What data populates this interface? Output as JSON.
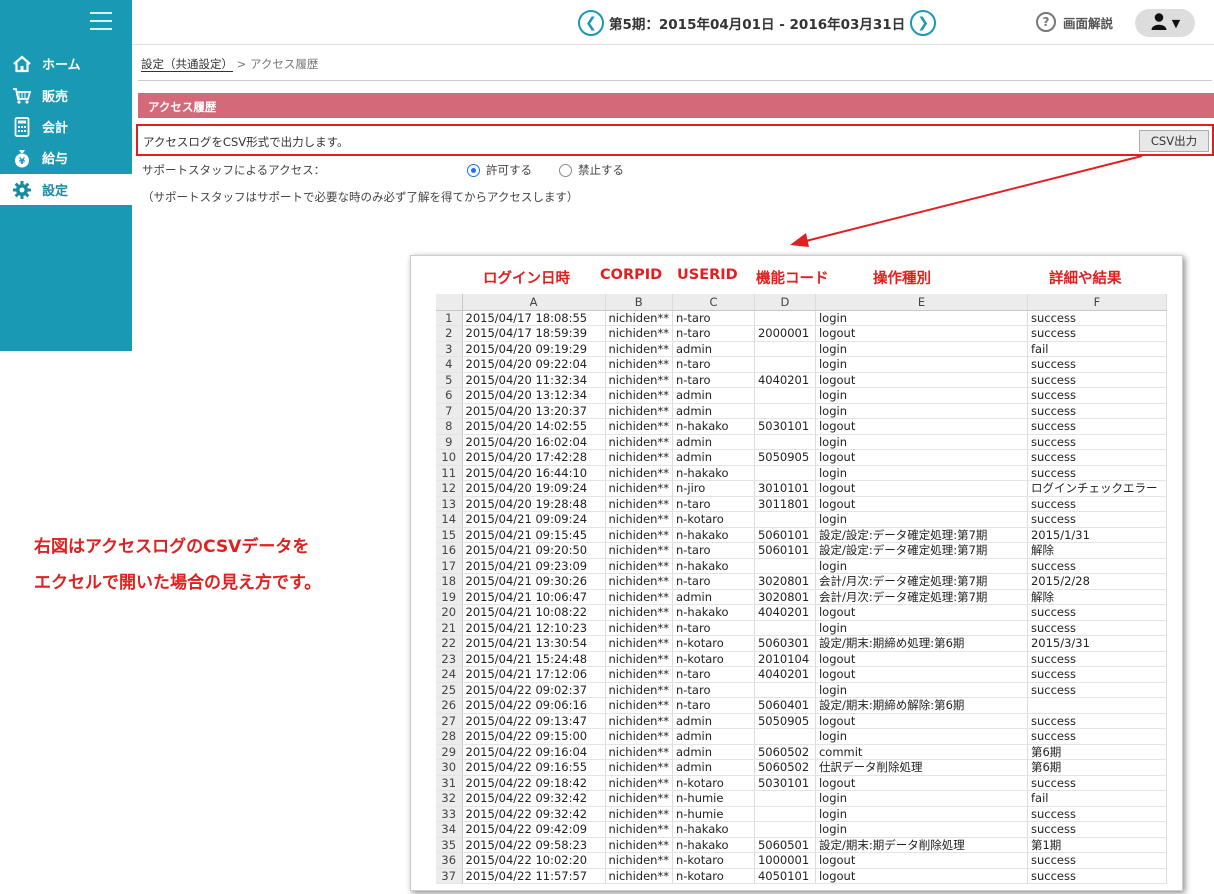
{
  "nav": {
    "items": [
      {
        "label": "ホーム",
        "icon": "home-icon"
      },
      {
        "label": "販売",
        "icon": "cart-icon"
      },
      {
        "label": "会計",
        "icon": "calculator-icon"
      },
      {
        "label": "給与",
        "icon": "money-bag-icon"
      },
      {
        "label": "設定",
        "icon": "gear-icon"
      }
    ]
  },
  "header": {
    "period": "第5期：2015年04月01日 - 2016年03月31日",
    "help_label": "画面解説"
  },
  "breadcrumb": {
    "parent": "設定（共通設定）",
    "separator": " > ",
    "current": "アクセス履歴"
  },
  "section": {
    "title": "アクセス履歴",
    "csv_description": "アクセスログをCSV形式で出力します。",
    "csv_button": "CSV出力",
    "support_label": "サポートスタッフによるアクセス：",
    "allow_label": "許可する",
    "deny_label": "禁止する",
    "support_note": "（サポートスタッフはサポートで必要な時のみ必ず了解を得てからアクセスします）"
  },
  "caption": {
    "line1": "右図はアクセスログのCSVデータを",
    "line2": "エクセルで開いた場合の見え方です。"
  },
  "sheet": {
    "field_labels": [
      "ログイン日時",
      "CORPID",
      "USERID",
      "機能コード",
      "操作種別",
      "詳細や結果"
    ],
    "columns": [
      "A",
      "B",
      "C",
      "D",
      "E",
      "F"
    ],
    "rows": [
      [
        "1",
        "2015/04/17 18:08:55",
        "nichiden**",
        "n-taro",
        "",
        "login",
        "success"
      ],
      [
        "2",
        "2015/04/17 18:59:39",
        "nichiden**",
        "n-taro",
        "2000001",
        "logout",
        "success"
      ],
      [
        "3",
        "2015/04/20 09:19:29",
        "nichiden**",
        "admin",
        "",
        "login",
        "fail"
      ],
      [
        "4",
        "2015/04/20 09:22:04",
        "nichiden**",
        "n-taro",
        "",
        "login",
        "success"
      ],
      [
        "5",
        "2015/04/20 11:32:34",
        "nichiden**",
        "n-taro",
        "4040201",
        "logout",
        "success"
      ],
      [
        "6",
        "2015/04/20 13:12:34",
        "nichiden**",
        "admin",
        "",
        "login",
        "success"
      ],
      [
        "7",
        "2015/04/20 13:20:37",
        "nichiden**",
        "admin",
        "",
        "login",
        "success"
      ],
      [
        "8",
        "2015/04/20 14:02:55",
        "nichiden**",
        "n-hakako",
        "5030101",
        "logout",
        "success"
      ],
      [
        "9",
        "2015/04/20 16:02:04",
        "nichiden**",
        "admin",
        "",
        "login",
        "success"
      ],
      [
        "10",
        "2015/04/20 17:42:28",
        "nichiden**",
        "admin",
        "5050905",
        "logout",
        "success"
      ],
      [
        "11",
        "2015/04/20 16:44:10",
        "nichiden**",
        "n-hakako",
        "",
        "login",
        "success"
      ],
      [
        "12",
        "2015/04/20 19:09:24",
        "nichiden**",
        "n-jiro",
        "3010101",
        "logout",
        "ログインチェックエラー"
      ],
      [
        "13",
        "2015/04/20 19:28:48",
        "nichiden**",
        "n-taro",
        "3011801",
        "logout",
        "success"
      ],
      [
        "14",
        "2015/04/21 09:09:24",
        "nichiden**",
        "n-kotaro",
        "",
        "login",
        "success"
      ],
      [
        "15",
        "2015/04/21 09:15:45",
        "nichiden**",
        "n-hakako",
        "5060101",
        "設定/設定:データ確定処理:第7期",
        "2015/1/31"
      ],
      [
        "16",
        "2015/04/21 09:20:50",
        "nichiden**",
        "n-taro",
        "5060101",
        "設定/設定:データ確定処理:第7期",
        "解除"
      ],
      [
        "17",
        "2015/04/21 09:23:09",
        "nichiden**",
        "n-hakako",
        "",
        "login",
        "success"
      ],
      [
        "18",
        "2015/04/21 09:30:26",
        "nichiden**",
        "n-taro",
        "3020801",
        "会計/月次:データ確定処理:第7期",
        "2015/2/28"
      ],
      [
        "19",
        "2015/04/21 10:06:47",
        "nichiden**",
        "admin",
        "3020801",
        "会計/月次:データ確定処理:第7期",
        "解除"
      ],
      [
        "20",
        "2015/04/21 10:08:22",
        "nichiden**",
        "n-hakako",
        "4040201",
        "logout",
        "success"
      ],
      [
        "21",
        "2015/04/21 12:10:23",
        "nichiden**",
        "n-taro",
        "",
        "login",
        "success"
      ],
      [
        "22",
        "2015/04/21 13:30:54",
        "nichiden**",
        "n-kotaro",
        "5060301",
        "設定/期末:期締め処理:第6期",
        "2015/3/31"
      ],
      [
        "23",
        "2015/04/21 15:24:48",
        "nichiden**",
        "n-kotaro",
        "2010104",
        "logout",
        "success"
      ],
      [
        "24",
        "2015/04/21 17:12:06",
        "nichiden**",
        "n-taro",
        "4040201",
        "logout",
        "success"
      ],
      [
        "25",
        "2015/04/22 09:02:37",
        "nichiden**",
        "n-taro",
        "",
        "login",
        "success"
      ],
      [
        "26",
        "2015/04/22 09:06:16",
        "nichiden**",
        "n-taro",
        "5060401",
        "設定/期末:期締め解除:第6期",
        ""
      ],
      [
        "27",
        "2015/04/22 09:13:47",
        "nichiden**",
        "admin",
        "5050905",
        "logout",
        "success"
      ],
      [
        "28",
        "2015/04/22 09:15:00",
        "nichiden**",
        "admin",
        "",
        "login",
        "success"
      ],
      [
        "29",
        "2015/04/22 09:16:04",
        "nichiden**",
        "admin",
        "5060502",
        "commit",
        "第6期"
      ],
      [
        "30",
        "2015/04/22 09:16:55",
        "nichiden**",
        "admin",
        "5060502",
        "仕訳データ削除処理",
        "第6期"
      ],
      [
        "31",
        "2015/04/22 09:18:42",
        "nichiden**",
        "n-kotaro",
        "5030101",
        "logout",
        "success"
      ],
      [
        "32",
        "2015/04/22 09:32:42",
        "nichiden**",
        "n-humie",
        "",
        "login",
        "fail"
      ],
      [
        "33",
        "2015/04/22 09:32:42",
        "nichiden**",
        "n-humie",
        "",
        "login",
        "success"
      ],
      [
        "34",
        "2015/04/22 09:42:09",
        "nichiden**",
        "n-hakako",
        "",
        "login",
        "success"
      ],
      [
        "35",
        "2015/04/22 09:58:23",
        "nichiden**",
        "n-hakako",
        "5060501",
        "設定/期末:期データ削除処理",
        "第1期"
      ],
      [
        "36",
        "2015/04/22 10:02:20",
        "nichiden**",
        "n-kotaro",
        "1000001",
        "logout",
        "success"
      ],
      [
        "37",
        "2015/04/22 11:57:57",
        "nichiden**",
        "n-kotaro",
        "4050101",
        "logout",
        "success"
      ]
    ]
  },
  "colors": {
    "sidebar": "#1a99b4",
    "section_bar": "#d4697a",
    "highlight": "#e02020"
  }
}
